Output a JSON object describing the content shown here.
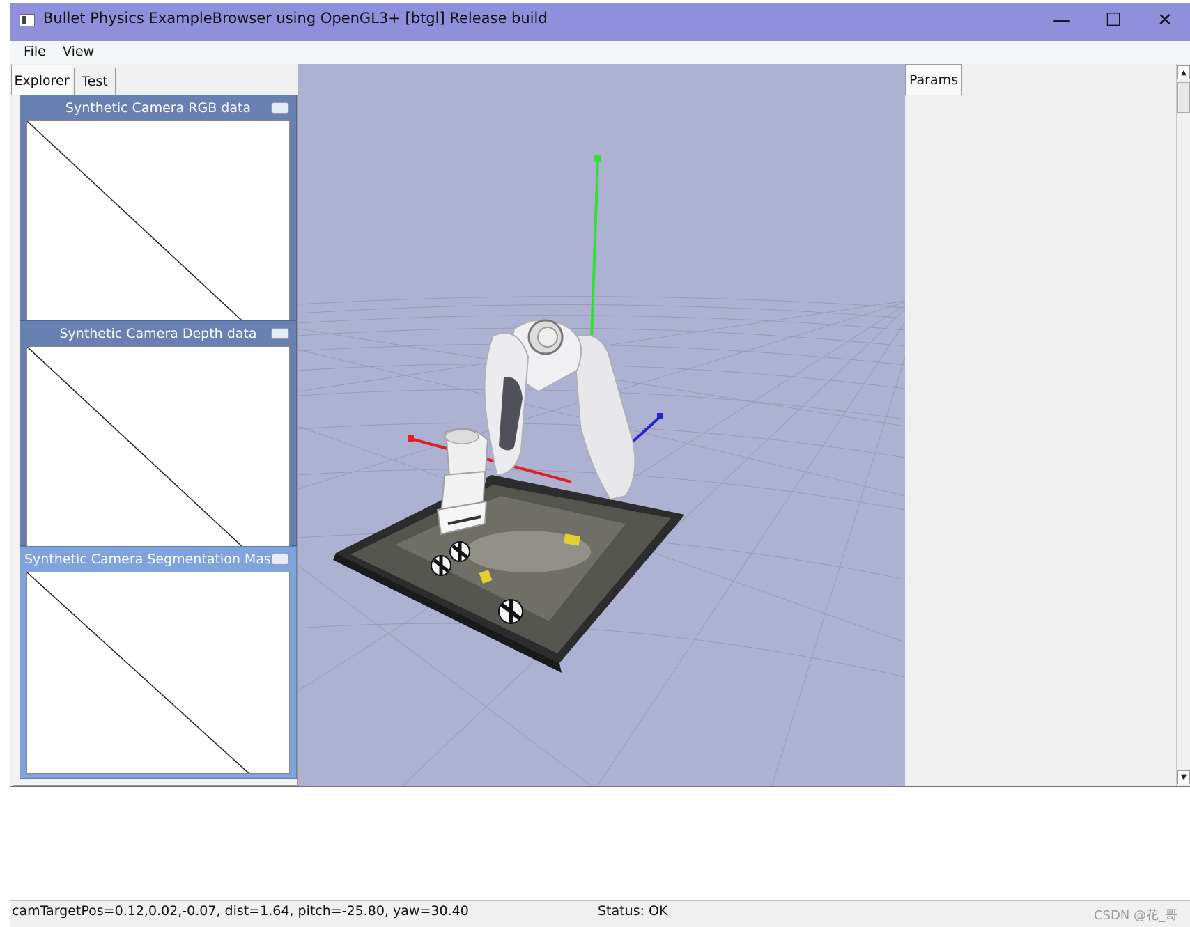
{
  "window": {
    "title": "Bullet Physics ExampleBrowser using OpenGL3+ [btgl] Release build",
    "controls": {
      "minimize": "—",
      "maximize": "☐",
      "close": "✕"
    }
  },
  "menu": {
    "items": [
      "File",
      "View"
    ]
  },
  "left_tabs": [
    "Explorer",
    "Test"
  ],
  "camera_panels": [
    {
      "title": "Synthetic Camera RGB data"
    },
    {
      "title": "Synthetic Camera Depth data"
    },
    {
      "title": "Synthetic Camera Segmentation Mask"
    }
  ],
  "right_tabs": [
    "Params"
  ],
  "status": {
    "camera": "camTargetPos=0.12,0.02,-0.07, dist=1.64, pitch=-25.80, yaw=30.40",
    "state": "Status: OK"
  },
  "watermark": "CSDN @花_哥",
  "colors": {
    "titlebar": "#8f8fdc",
    "viewport_bg": "#aeb2d2",
    "camera_header": "#6880b2",
    "axis_x": "#e02020",
    "axis_y": "#30e030",
    "axis_z": "#2020d0"
  },
  "icons": [
    "app-icon",
    "minimize-icon",
    "maximize-icon",
    "close-icon",
    "collapse-icon",
    "scroll-up-icon",
    "scroll-down-icon"
  ]
}
